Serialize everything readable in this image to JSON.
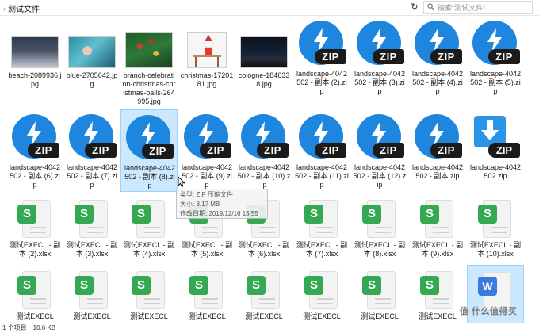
{
  "breadcrumb": {
    "folder": "测试文件"
  },
  "search": {
    "placeholder": "搜索\"测试文件\""
  },
  "files": [
    {
      "name": "beach-2089936.jpg",
      "type": "photo",
      "variant": "beach"
    },
    {
      "name": "blue-2705642.jpg",
      "type": "photo",
      "variant": "blue"
    },
    {
      "name": "branch-celebration-christmas-christmas-balls-264995.jpg",
      "type": "photo",
      "variant": "branch"
    },
    {
      "name": "christmas-1720181.jpg",
      "type": "photo",
      "variant": "christmas"
    },
    {
      "name": "cologne-1846338.jpg",
      "type": "photo",
      "variant": "cologne"
    },
    {
      "name": "landscape-4042502 - 副本 (2).zip",
      "type": "zip"
    },
    {
      "name": "landscape-4042502 - 副本 (3).zip",
      "type": "zip"
    },
    {
      "name": "landscape-4042502 - 副本 (4).zip",
      "type": "zip"
    },
    {
      "name": "landscape-4042502 - 副本 (5).zip",
      "type": "zip"
    },
    {
      "name": "landscape-4042502 - 副本 (6).zip",
      "type": "zip"
    },
    {
      "name": "landscape-4042502 - 副本 (7).zip",
      "type": "zip"
    },
    {
      "name": "landscape-4042502 - 副本 (8).zip",
      "type": "zip",
      "selected": true
    },
    {
      "name": "landscape-4042502 - 副本 (9).zip",
      "type": "zip"
    },
    {
      "name": "landscape-4042502 - 副本 (10).zip",
      "type": "zip"
    },
    {
      "name": "landscape-4042502 - 副本 (11).zip",
      "type": "zip"
    },
    {
      "name": "landscape-4042502 - 副本 (12).zip",
      "type": "zip"
    },
    {
      "name": "landscape-4042502 - 副本.zip",
      "type": "zip"
    },
    {
      "name": "landscape-4042502.zip",
      "type": "zipdl"
    },
    {
      "name": "测试EXECL - 副本 (2).xlsx",
      "type": "xlsx"
    },
    {
      "name": "测试EXECL - 副本 (3).xlsx",
      "type": "xlsx"
    },
    {
      "name": "测试EXECL - 副本 (4).xlsx",
      "type": "xlsx"
    },
    {
      "name": "测试EXECL - 副本 (5).xlsx",
      "type": "xlsx"
    },
    {
      "name": "测试EXECL - 副本 (6).xlsx",
      "type": "xlsx"
    },
    {
      "name": "测试EXECL - 副本 (7).xlsx",
      "type": "xlsx"
    },
    {
      "name": "测试EXECL - 副本 (8).xlsx",
      "type": "xlsx"
    },
    {
      "name": "测试EXECL - 副本 (9).xlsx",
      "type": "xlsx"
    },
    {
      "name": "测试EXECL - 副本 (10).xlsx",
      "type": "xlsx"
    },
    {
      "name": "测试EXECL",
      "type": "xlsx"
    },
    {
      "name": "测试EXECL",
      "type": "xlsx"
    },
    {
      "name": "测试EXECL",
      "type": "xlsx"
    },
    {
      "name": "测试EXECL",
      "type": "xlsx"
    },
    {
      "name": "测试EXECL",
      "type": "xlsx"
    },
    {
      "name": "测试EXECL",
      "type": "xlsx"
    },
    {
      "name": "测试EXECL",
      "type": "xlsx"
    },
    {
      "name": "测试EXECL",
      "type": "xlsx"
    },
    {
      "name": "",
      "type": "word",
      "selected": true
    }
  ],
  "icon_labels": {
    "zip": "ZIP",
    "xlsx": "S",
    "word": "W"
  },
  "tooltip": {
    "type_line": "类型: ZIP 压缩文件",
    "size_line": "大小: 8.17 MB",
    "date_line": "修改日期: 2019/12/16 15:55"
  },
  "status": {
    "selection": "1 个项目",
    "size": "10.6 KB"
  },
  "watermark": "值 什么值得买",
  "colors": {
    "zip_blue": "#1f86e0",
    "xlsx_green": "#34a853",
    "word_blue": "#3b7be0",
    "selection": "#cce8ff"
  }
}
